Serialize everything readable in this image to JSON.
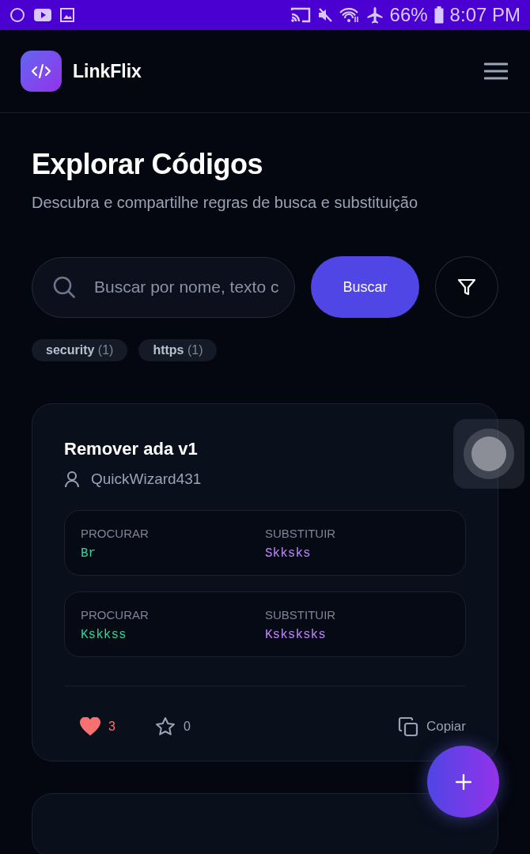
{
  "status_bar": {
    "battery": "66%",
    "time": "8:07 PM"
  },
  "header": {
    "app_name": "LinkFlix"
  },
  "page": {
    "title": "Explorar Códigos",
    "subtitle": "Descubra e compartilhe regras de busca e substituição"
  },
  "search": {
    "placeholder": "Buscar por nome, texto c",
    "button": "Buscar"
  },
  "tags": [
    {
      "name": "security",
      "count": "(1)"
    },
    {
      "name": "https",
      "count": "(1)"
    }
  ],
  "cards": [
    {
      "title": "Remover ada v1",
      "author": "QuickWizard431",
      "rules": [
        {
          "find_label": "PROCURAR",
          "find": "Br",
          "replace_label": "SUBSTITUIR",
          "replace": "Skksks"
        },
        {
          "find_label": "PROCURAR",
          "find": "Kskkss",
          "replace_label": "SUBSTITUIR",
          "replace": "Ksksksks"
        }
      ],
      "likes": "3",
      "liked": true,
      "favorites": "0",
      "favorited": false,
      "copy_label": "Copiar"
    }
  ]
}
